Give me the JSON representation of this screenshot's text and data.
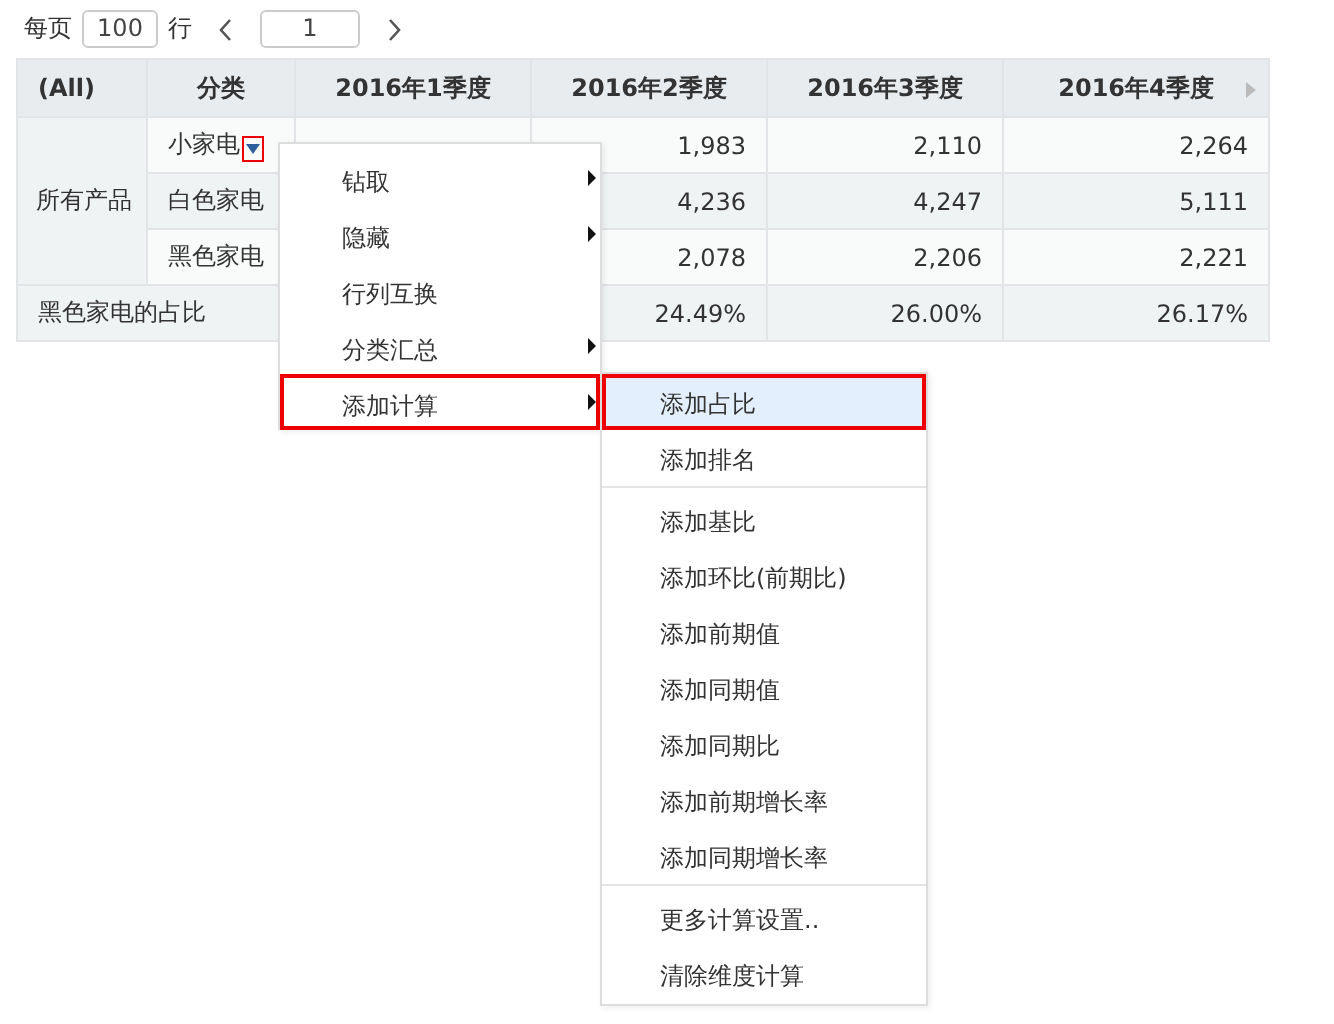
{
  "pager": {
    "per_page_label": "每页",
    "per_page": "100",
    "rows_label": "行",
    "page": "1"
  },
  "table": {
    "columns": [
      "(All)",
      "分类",
      "2016年1季度",
      "2016年2季度",
      "2016年3季度",
      "2016年4季度"
    ],
    "groups": [
      {
        "label": "所有产品",
        "rows": [
          {
            "category": "小家电",
            "selected": true,
            "values": [
              "1,983",
              "2,110",
              "2,264"
            ]
          },
          {
            "category": "白色家电",
            "selected": false,
            "values": [
              "4,236",
              "4,247",
              "5,111"
            ]
          },
          {
            "category": "黑色家电",
            "selected": false,
            "values": [
              "2,078",
              "2,206",
              "2,221"
            ]
          }
        ]
      }
    ],
    "summary": {
      "label": "黑色家电的占比",
      "values": [
        "24.49%",
        "26.00%",
        "26.17%"
      ]
    }
  },
  "context_menu": {
    "items": [
      {
        "label": "钻取",
        "has_submenu": true,
        "selected": false
      },
      {
        "label": "隐藏",
        "has_submenu": true,
        "selected": false
      },
      {
        "label": "行列互换",
        "has_submenu": false,
        "selected": false
      },
      {
        "label": "分类汇总",
        "has_submenu": true,
        "selected": false
      },
      {
        "label": "添加计算",
        "has_submenu": true,
        "selected": true
      }
    ]
  },
  "submenu": {
    "sections": [
      [
        {
          "label": "添加占比",
          "selected": true
        },
        {
          "label": "添加排名",
          "selected": false
        }
      ],
      [
        {
          "label": "添加基比",
          "selected": false
        },
        {
          "label": "添加环比(前期比)",
          "selected": false
        },
        {
          "label": "添加前期值",
          "selected": false
        },
        {
          "label": "添加同期值",
          "selected": false
        },
        {
          "label": "添加同期比",
          "selected": false
        },
        {
          "label": "添加前期增长率",
          "selected": false
        },
        {
          "label": "添加同期增长率",
          "selected": false
        }
      ],
      [
        {
          "label": "更多计算设置..",
          "selected": false
        },
        {
          "label": "清除维度计算",
          "selected": false
        }
      ]
    ]
  }
}
